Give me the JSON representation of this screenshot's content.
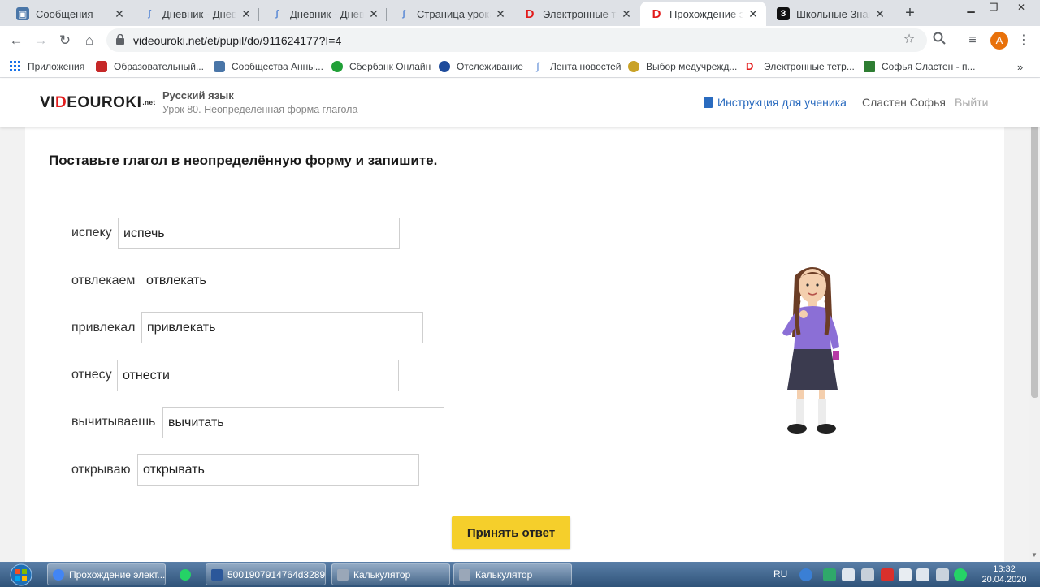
{
  "browser": {
    "tabs": [
      {
        "title": "Сообщения",
        "favicon": "vk-icon",
        "color": "#4a76a8"
      },
      {
        "title": "Дневник - Дневник",
        "favicon": "diary-icon",
        "color": "#5b8ad6"
      },
      {
        "title": "Дневник - Дневник",
        "favicon": "diary-icon",
        "color": "#5b8ad6"
      },
      {
        "title": "Страница урока - ",
        "favicon": "diary-icon",
        "color": "#5b8ad6"
      },
      {
        "title": "Электронные тетр",
        "favicon": "videouroki-icon",
        "color": "#e21b1b"
      },
      {
        "title": "Прохождение эле",
        "favicon": "videouroki-icon",
        "color": "#e21b1b"
      },
      {
        "title": "Школьные Знания",
        "favicon": "znania-icon",
        "color": "#111111"
      }
    ],
    "active_tab_index": 5,
    "url": "videouroki.net/et/pupil/do/911624177?I=4",
    "profile_initial": "A",
    "bookmarks": [
      {
        "label": "Приложения",
        "icon": "apps-grid-icon",
        "color": "#1a73e8"
      },
      {
        "label": "Образовательный...",
        "icon": "school-icon",
        "color": "#c62828"
      },
      {
        "label": "Сообщества Анны...",
        "icon": "vk-icon",
        "color": "#4a76a8"
      },
      {
        "label": "Сбербанк Онлайн",
        "icon": "sber-icon",
        "color": "#21a038"
      },
      {
        "label": "Отслеживание",
        "icon": "post-icon",
        "color": "#1e4b9b"
      },
      {
        "label": "Лента новостей",
        "icon": "diary-icon",
        "color": "#5b8ad6"
      },
      {
        "label": "Выбор медучрежд...",
        "icon": "emblem-icon",
        "color": "#c9a227"
      },
      {
        "label": "Электронные тетр...",
        "icon": "videouroki-icon",
        "color": "#e21b1b"
      },
      {
        "label": "Софья Сластен - п...",
        "icon": "sheet-icon",
        "color": "#2e7d32"
      }
    ]
  },
  "site": {
    "logo_pre": "VI",
    "logo_red": "D",
    "logo_post": "EOUROKI",
    "logo_suffix": ".net",
    "course": "Русский язык",
    "lesson": "Урок 80. Неопределённая форма глагола",
    "instructions_link": "Инструкция для ученика",
    "user_name": "Сластен Софья",
    "logout": "Выйти"
  },
  "exercise": {
    "instruction": "Поставьте глагол в неопределённую форму и запишите.",
    "rows": [
      {
        "word": "испеку",
        "answer": "испечь"
      },
      {
        "word": "отвлекаем",
        "answer": "отвлекать"
      },
      {
        "word": "привлекал",
        "answer": "привлекать"
      },
      {
        "word": "отнесу",
        "answer": "отнести"
      },
      {
        "word": "вычитываешь",
        "answer": "вычитать"
      },
      {
        "word": "открываю",
        "answer": "открывать"
      }
    ],
    "submit_label": "Принять ответ"
  },
  "taskbar": {
    "items": [
      {
        "label": "Прохождение элект...",
        "icon": "chrome-icon",
        "color": "#4285f4"
      },
      {
        "label": "",
        "icon": "whatsapp-icon",
        "color": "#25d366"
      },
      {
        "label": "5001907914764d3289...",
        "icon": "word-icon",
        "color": "#2b579a"
      },
      {
        "label": "Калькулятор",
        "icon": "calculator-icon",
        "color": "#9aa7b8"
      },
      {
        "label": "Калькулятор",
        "icon": "calculator-icon",
        "color": "#9aa7b8"
      }
    ],
    "language": "RU",
    "time": "13:32",
    "date": "20.04.2020"
  }
}
